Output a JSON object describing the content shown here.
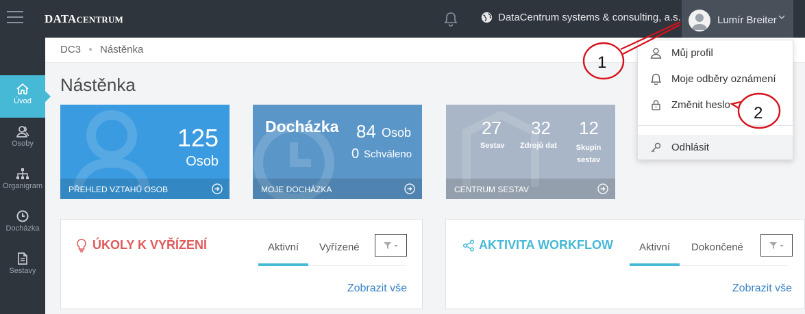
{
  "header": {
    "logo_main": "DATA",
    "logo_rest": "CENTRUM",
    "organization": "DataCentrum systems & consulting, a.s.",
    "user_name": "Lumír Breiter"
  },
  "nav": {
    "items": [
      {
        "label": "Úvod",
        "icon": "home-icon"
      },
      {
        "label": "Osoby",
        "icon": "people-icon"
      },
      {
        "label": "Organigram",
        "icon": "org-chart-icon"
      },
      {
        "label": "Docházka",
        "icon": "clock-icon"
      },
      {
        "label": "Sestavy",
        "icon": "reports-icon"
      }
    ]
  },
  "breadcrumb": {
    "root": "DC3",
    "current": "Nástěnka"
  },
  "page": {
    "title": "Nástěnka"
  },
  "tiles": {
    "persons": {
      "value": "125",
      "unit": "Osob",
      "footer": "PŘEHLED VZTAHŮ OSOB",
      "color": "#3b9be0"
    },
    "attendance": {
      "title": "Docházka",
      "value": "84",
      "unit": "Osob",
      "approved_value": "0",
      "approved_label": "Schváleno",
      "footer": "MOJE DOCHÁZKA",
      "color": "#5b96c9"
    },
    "reports": {
      "stats": [
        {
          "value": "27",
          "label": "Sestav"
        },
        {
          "value": "32",
          "label": "Zdrojů dat"
        },
        {
          "value": "12",
          "label": "Skupin sestav"
        }
      ],
      "footer": "CENTRUM SESTAV",
      "color": "#a9b6c7"
    }
  },
  "panels": {
    "tasks": {
      "title": "ÚKOLY K VYŘÍZENÍ",
      "tab_active": "Aktivní",
      "tab_other": "Vyřízené",
      "more": "Zobrazit vše",
      "color": "#e05a5a"
    },
    "workflow": {
      "title": "AKTIVITA WORKFLOW",
      "tab_active": "Aktivní",
      "tab_other": "Dokončené",
      "more": "Zobrazit vše",
      "color": "#46b9d6"
    }
  },
  "dropdown": {
    "items": [
      {
        "label": "Můj profil",
        "icon": "user-icon"
      },
      {
        "label": "Moje odběry oznámení",
        "icon": "bell-icon"
      },
      {
        "label": "Změnit heslo",
        "icon": "lock-icon"
      },
      {
        "label": "Odhlásit",
        "icon": "key-icon"
      }
    ]
  },
  "annotations": {
    "first": "1",
    "second": "2",
    "color": "#d6111b"
  }
}
